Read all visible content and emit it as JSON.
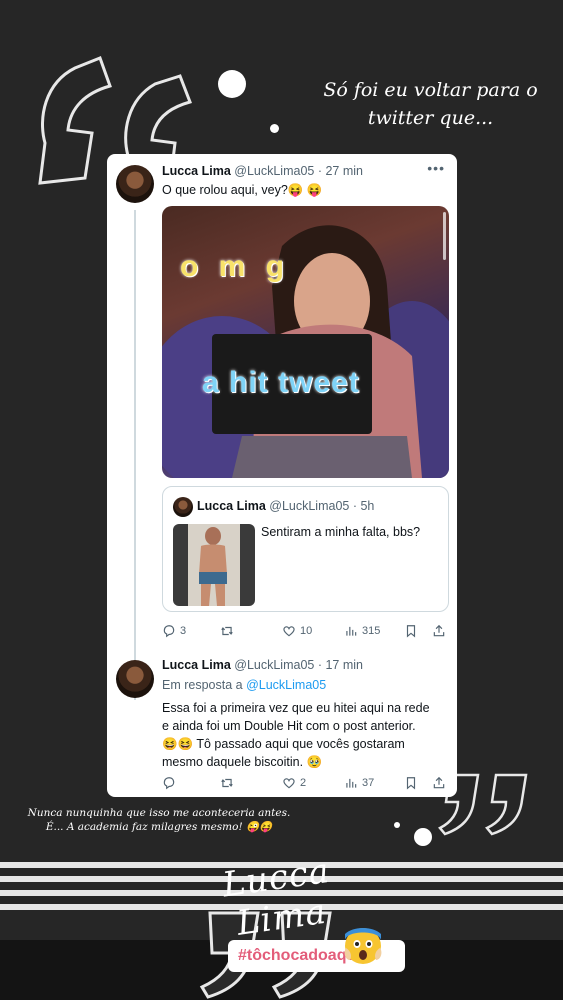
{
  "caption_top": "Só foi eu voltar para o twitter que...",
  "caption_bottom_line1": "Nunca nunquinha que isso me aconteceria antes.",
  "caption_bottom_line2": "É... A academia faz milagres mesmo! 😜😝",
  "signature": "Lucca Lima",
  "hashtag": {
    "prefix": "#",
    "text": "tôchocadoaqui"
  },
  "colors": {
    "background": "#262626",
    "accent_link": "#1d9bf0",
    "hashtag": "#e35d7a"
  },
  "tweet1": {
    "name": "Lucca Lima",
    "handle_time": "@LuckLima05 · 27 min",
    "text": "O que rolou aqui, vey?😝 😝",
    "media_text_top": "o m g",
    "media_text_bottom": "a hit tweet",
    "quoted": {
      "name": "Lucca Lima",
      "handle_time": "@LuckLima05 · 5h",
      "text": "Sentiram a minha falta, bbs?"
    },
    "actions": {
      "replies": "3",
      "retweets": "",
      "likes": "10",
      "views": "315"
    }
  },
  "tweet2": {
    "name": "Lucca Lima",
    "handle_time": "@LuckLima05 · 17 min",
    "reply_prefix": "Em resposta a",
    "reply_to": "@LuckLima05",
    "text_line1": "Essa foi a primeira vez que eu hitei aqui na rede",
    "text_line2": "e ainda foi um Double Hit com o post anterior.",
    "text_line3": "😆😆 Tô passado aqui que vocês gostaram",
    "text_line4": "mesmo daquele biscoitin. 🥹",
    "actions": {
      "replies": "",
      "retweets": "",
      "likes": "2",
      "views": "37"
    }
  },
  "icons": [
    "more-icon",
    "reply-icon",
    "retweet-icon",
    "like-icon",
    "views-icon",
    "bookmark-icon",
    "share-icon"
  ]
}
